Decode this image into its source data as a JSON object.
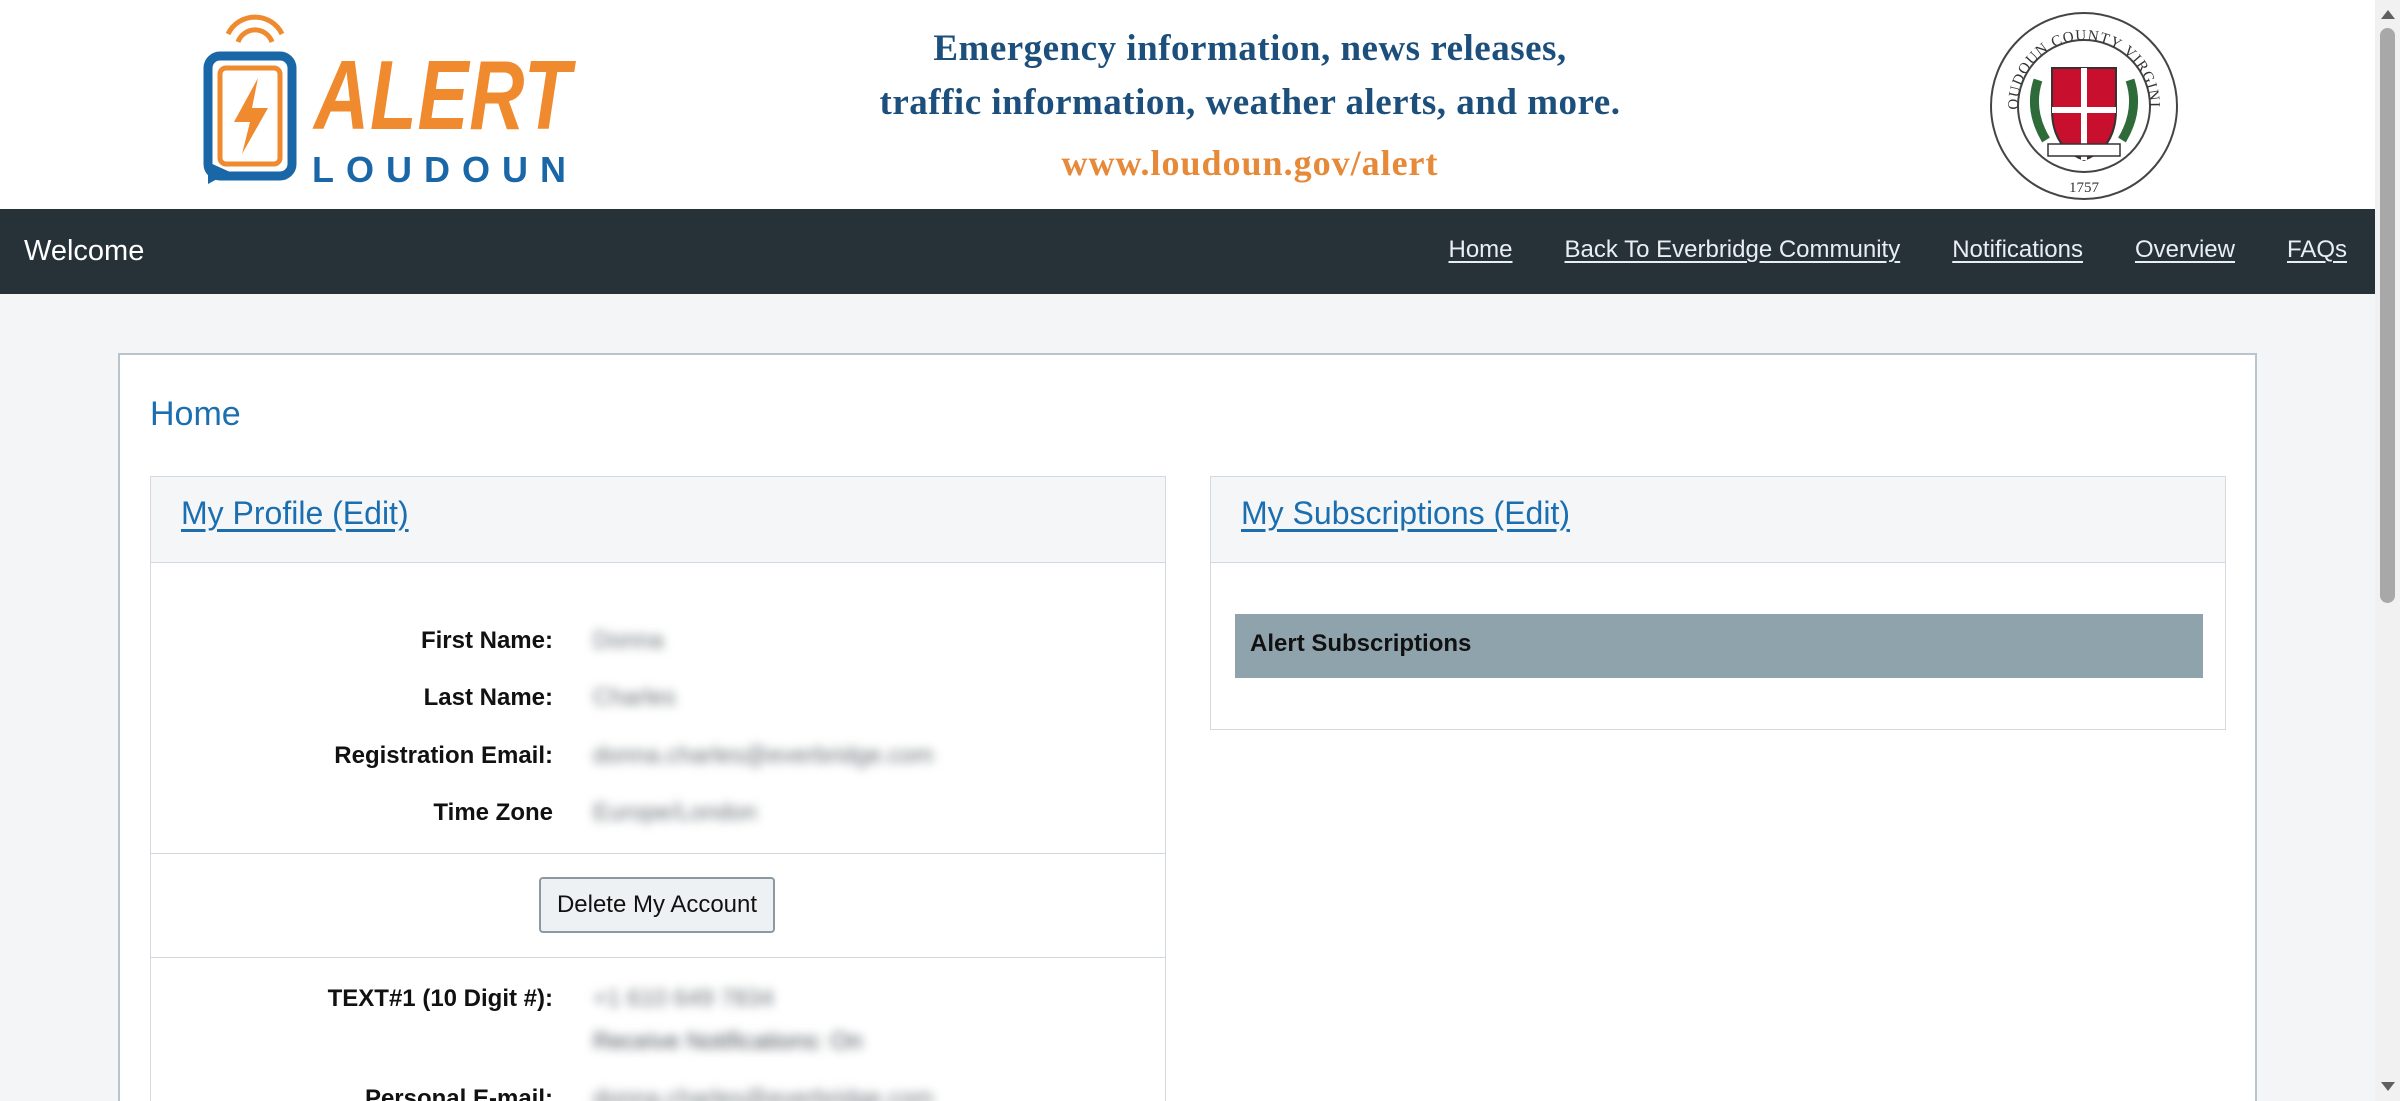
{
  "banner": {
    "logo": {
      "word1": "ALERT",
      "word2": "LOUDOUN"
    },
    "tagline_line1": "Emergency information, news releases,",
    "tagline_line2": "traffic information, weather alerts, and more.",
    "url": "www.loudoun.gov/alert",
    "seal": {
      "top_text": "LOUDOUN COUNTY VIRGINIA",
      "year": "1757"
    }
  },
  "nav": {
    "brand": "Welcome",
    "links": [
      "Home",
      "Back To Everbridge Community",
      "Notifications",
      "Overview",
      "FAQs"
    ]
  },
  "main": {
    "title": "Home",
    "profile": {
      "heading": "My Profile (Edit)",
      "fields": [
        {
          "label": "First Name:",
          "value": "Donna"
        },
        {
          "label": "Last Name:",
          "value": "Charles"
        },
        {
          "label": "Registration Email:",
          "value": "donna.charles@everbridge.com"
        },
        {
          "label": "Time Zone",
          "value": "Europe/London"
        }
      ],
      "delete_button": "Delete My Account",
      "contacts": [
        {
          "label": "TEXT#1 (10 Digit #):",
          "value": "+1 610 649 7834",
          "sub": "Receive Notifications: On"
        },
        {
          "label": "Personal E-mail:",
          "value": "donna.charles@everbridge.com"
        }
      ]
    },
    "subscriptions": {
      "heading": "My Subscriptions (Edit)",
      "section": "Alert Subscriptions"
    }
  },
  "colors": {
    "nav_bg": "#263238",
    "link_blue": "#1b6fb0",
    "logo_orange": "#f08a2e",
    "logo_blue": "#1a67a8",
    "subs_bar": "#8fa3ad"
  },
  "icons": [
    "alert-loudoun-logo-icon",
    "loudoun-county-seal-icon"
  ]
}
